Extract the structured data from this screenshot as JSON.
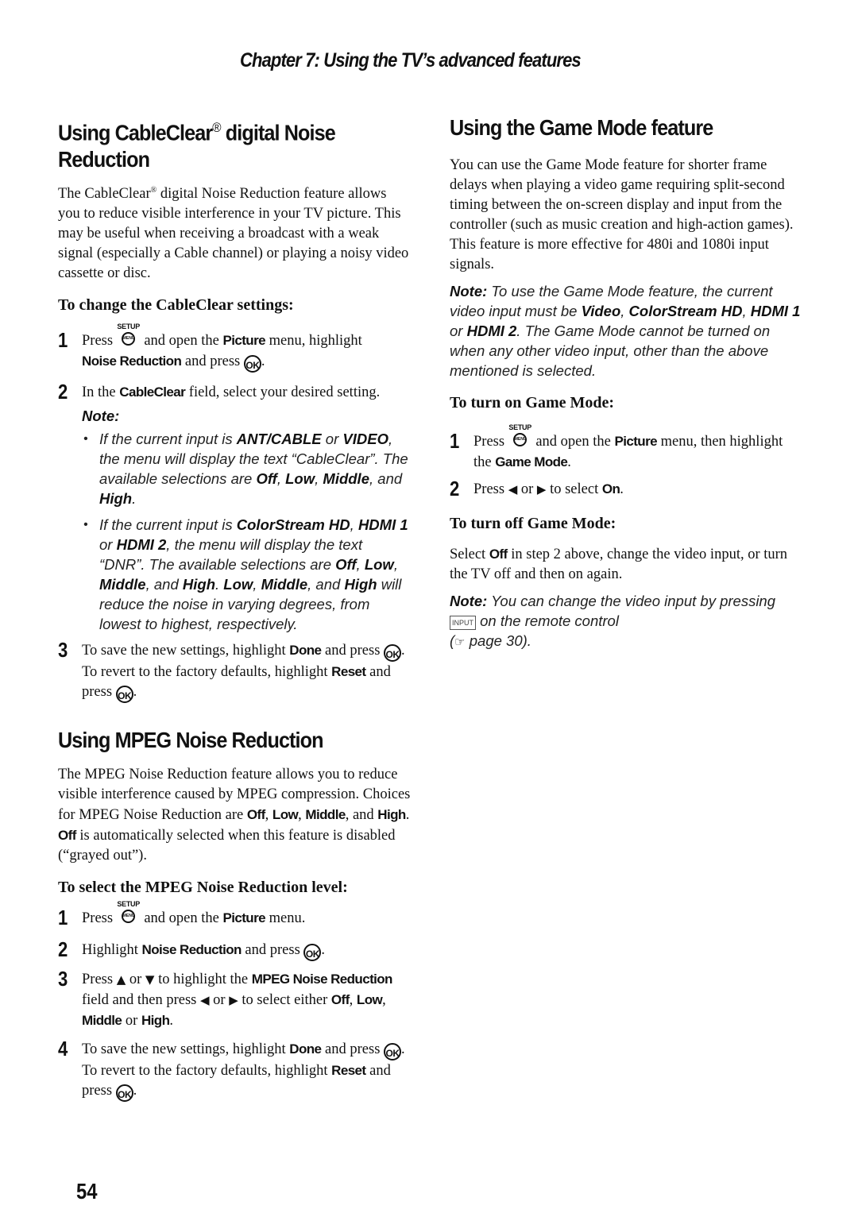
{
  "header": {
    "chapter_title": "Chapter 7: Using the TV’s advanced features"
  },
  "page_number": "54",
  "icons": {
    "setup_label": "SETUP",
    "menu_label": "MENU",
    "ok_label": "OK",
    "input_label": "INPUT",
    "left_arrow": "◀",
    "right_arrow": "▶",
    "up_arrow": "▲",
    "down_arrow": "▼",
    "pointing_hand": "☞"
  },
  "cableclear": {
    "title_a": "Using CableClear",
    "reg": "®",
    "title_b": " digital Noise",
    "title_line2": "Reduction",
    "intro_a": "The CableClear",
    "intro_b": " digital Noise Reduction feature allows you to reduce visible interference in your TV picture. This may be useful when receiving a broadcast with a weak signal (especially a Cable channel) or playing a noisy video cassette or disc.",
    "subheading": "To change the CableClear settings:",
    "step1": {
      "num": "1",
      "a": "Press ",
      "b": " and open the ",
      "picture": "Picture",
      "c": " menu, highlight ",
      "noise_reduction": "Noise Reduction",
      "d": " and press ",
      "e": "."
    },
    "step2": {
      "num": "2",
      "a": "In the ",
      "cableclear": "CableClear",
      "b": " field, select your desired setting."
    },
    "note_label": "Note:",
    "bullet": "•",
    "note1": {
      "a": "If the current input is ",
      "ant": "ANT/CABLE",
      "b": " or ",
      "video": "VIDEO",
      "c": ", the menu will display the text “CableClear”. The available selections are ",
      "off": "Off",
      "s1": ", ",
      "low": "Low",
      "s2": ", ",
      "middle": "Middle",
      "s3": ", and ",
      "high": "High",
      "end": "."
    },
    "note2": {
      "a": "If the current input is ",
      "cs": "ColorStream HD",
      "s0": ", ",
      "hdmi1": "HDMI 1",
      "or": " or ",
      "hdmi2": "HDMI 2",
      "b": ", the menu will display the text “DNR”. The available selections are ",
      "off": "Off",
      "s1": ", ",
      "low": "Low",
      "s2": ", ",
      "middle": "Middle",
      "s3": ", and ",
      "high": "High",
      "s4": ". ",
      "low2": "Low",
      "s5": ", ",
      "middle2": "Middle",
      "s6": ", and ",
      "high2": "High",
      "c": " will reduce the noise in varying degrees, from lowest to highest, respectively."
    },
    "step3": {
      "num": "3",
      "a": "To save the new settings, highlight ",
      "done": "Done",
      "b": " and press ",
      "c": ".",
      "d": "To revert to the factory defaults, highlight ",
      "reset": "Reset",
      "e": " and press ",
      "f": "."
    }
  },
  "mpeg": {
    "title": "Using MPEG Noise Reduction",
    "intro_a": "The MPEG Noise Reduction feature allows you to reduce visible interference caused by MPEG compression. Choices for MPEG Noise Reduction are ",
    "off": "Off",
    "s1": ", ",
    "low": "Low",
    "s2": ", ",
    "middle": "Middle",
    "s3": ", and ",
    "high": "High",
    "s4": ". ",
    "off2": "Off",
    "intro_b": " is automatically selected when this feature is disabled (“grayed out”).",
    "subheading": "To select the MPEG Noise Reduction level:",
    "step1": {
      "num": "1",
      "a": "Press ",
      "b": " and open the ",
      "picture": "Picture",
      "c": " menu."
    },
    "step2": {
      "num": "2",
      "a": "Highlight ",
      "noise_reduction": "Noise Reduction",
      "b": " and press ",
      "c": "."
    },
    "step3": {
      "num": "3",
      "a": "Press ",
      "or1": " or ",
      "b": " to highlight the ",
      "field": "MPEG Noise Reduction",
      "c": " field and then press ",
      "or2": " or ",
      "d": " to select either ",
      "off": "Off",
      "s1": ", ",
      "low": "Low",
      "s2": ", ",
      "middle": "Middle",
      "or3": " or ",
      "high": "High",
      "end": "."
    },
    "step4": {
      "num": "4",
      "a": "To save the new settings, highlight ",
      "done": "Done",
      "b": " and press ",
      "c": ".",
      "d": "To revert to the factory defaults, highlight ",
      "reset": "Reset",
      "e": " and press ",
      "f": "."
    }
  },
  "game_mode": {
    "title": "Using the Game Mode feature",
    "intro1": "You can use the Game Mode feature for shorter frame delays when playing a video game requiring split-second timing between the on-screen display and input from the controller (such as music creation and high-action games).",
    "intro2": "This feature is more effective for 480i and 1080i input signals.",
    "note1": {
      "label": "Note:",
      "a": " To use the Game Mode feature, the current video input must be ",
      "video": "Video",
      "s1": ", ",
      "cs": "ColorStream HD",
      "s2": ", ",
      "hdmi1": "HDMI 1",
      "or": " or ",
      "hdmi2": "HDMI 2",
      "b": ". The Game Mode cannot be turned on when any other video input, other than the above mentioned is selected."
    },
    "on_heading": "To turn on Game Mode:",
    "on_step1": {
      "num": "1",
      "a": "Press ",
      "b": " and open the ",
      "picture": "Picture",
      "c": " menu, then highlight the ",
      "game_mode": "Game Mode",
      "d": "."
    },
    "on_step2": {
      "num": "2",
      "a": "Press ",
      "or": " or ",
      "b": " to select ",
      "on": "On",
      "c": "."
    },
    "off_heading": "To turn off Game Mode:",
    "off_text": {
      "a": "Select ",
      "off": "Off",
      "b": " in step 2 above, change the video input, or turn the TV off and then on again."
    },
    "note2": {
      "label": "Note:",
      "a": " You can change the video input by pressing ",
      "b": " on the remote control",
      "c": "(",
      "d": " page 30)."
    }
  }
}
